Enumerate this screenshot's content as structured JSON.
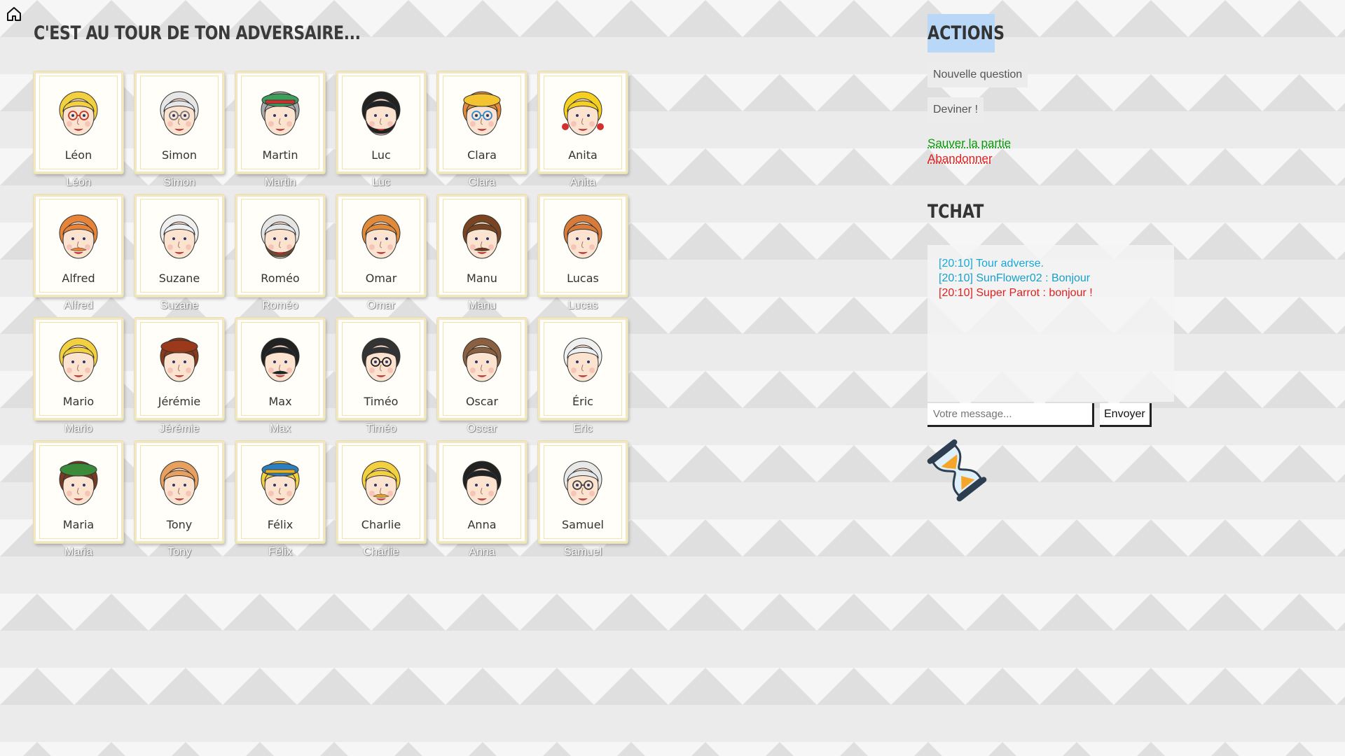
{
  "page": {
    "title": "C'EST AU TOUR DE TON ADVERSAIRE..."
  },
  "board": {
    "rows": [
      [
        {
          "name": "Léon",
          "hair": "#f2d040",
          "skin": "#fbe3cf",
          "glasses": "#c0392b",
          "beard": ""
        },
        {
          "name": "Simon",
          "hair": "#e6e6e6",
          "skin": "#fbe3cf",
          "glasses": "#777777",
          "beard": ""
        },
        {
          "name": "Martin",
          "hair": "#aaaaaa",
          "skin": "#fbe3cf",
          "hat": "#3aa05a",
          "hatband": "#d03030",
          "beard": ""
        },
        {
          "name": "Luc",
          "hair": "#222222",
          "skin": "#fbe3cf",
          "beard": "#222222"
        },
        {
          "name": "Clara",
          "hair": "#e08a3a",
          "skin": "#fbe3cf",
          "hat": "#f4c430",
          "glasses": "#2a8ad0",
          "beard": ""
        },
        {
          "name": "Anita",
          "hair": "#f5d020",
          "skin": "#fbe3cf",
          "bows": "#d03030",
          "beard": ""
        }
      ],
      [
        {
          "name": "Alfred",
          "hair": "#e8843a",
          "skin": "#fbe3cf",
          "beard": "",
          "mustache": "#e8843a"
        },
        {
          "name": "Suzane",
          "hair": "#f0f0f0",
          "skin": "#fbe3cf",
          "beard": ""
        },
        {
          "name": "Roméo",
          "hair": "#e5e5e5",
          "skin": "#fbe3cf",
          "beard": "#6a4a32"
        },
        {
          "name": "Omar",
          "hair": "#e08a3a",
          "skin": "#fbe3cf",
          "beard": ""
        },
        {
          "name": "Manu",
          "hair": "#7a4420",
          "skin": "#fbe3cf",
          "beard": "",
          "mustache": "#6a3a1a"
        },
        {
          "name": "Lucas",
          "hair": "#d87a3a",
          "skin": "#fbe3cf",
          "beard": ""
        }
      ],
      [
        {
          "name": "Mario",
          "hair": "#f2d040",
          "skin": "#fbe3cf",
          "beard": ""
        },
        {
          "name": "Jérémie",
          "hair": "#8a3a1a",
          "skin": "#fbe3cf",
          "hat": "#9a3a1a",
          "beard": ""
        },
        {
          "name": "Max",
          "hair": "#222222",
          "skin": "#fbe3cf",
          "beard": "",
          "mustache": "#222222"
        },
        {
          "name": "Timéo",
          "hair": "#333333",
          "skin": "#fbe3cf",
          "glasses": "#222222",
          "beard": ""
        },
        {
          "name": "Oscar",
          "hair": "#8a6040",
          "skin": "#fbe3cf",
          "beard": ""
        },
        {
          "name": "Éric",
          "hair": "#f0f0f0",
          "skin": "#fbe3cf",
          "beard": ""
        }
      ],
      [
        {
          "name": "Maria",
          "hair": "#7a3a20",
          "skin": "#fbe3cf",
          "hat": "#3a8a3a",
          "beard": ""
        },
        {
          "name": "Tony",
          "hair": "#e8a060",
          "skin": "#fbe3cf",
          "beard": ""
        },
        {
          "name": "Félix",
          "hair": "#f2d040",
          "skin": "#fbe3cf",
          "hat": "#2a80c0",
          "hatband": "#e8b020",
          "beard": ""
        },
        {
          "name": "Charlie",
          "hair": "#f2d040",
          "skin": "#fbe3cf",
          "beard": "",
          "mustache": "#e0a030"
        },
        {
          "name": "Anna",
          "hair": "#222222",
          "skin": "#fbe3cf",
          "beard": ""
        },
        {
          "name": "Samuel",
          "hair": "#e8e8e8",
          "skin": "#fbe3cf",
          "glasses": "#444444",
          "beard": ""
        }
      ]
    ]
  },
  "captions": [
    [
      "Léon",
      "Simon",
      "Martin",
      "Luc",
      "Clara",
      "Anita"
    ],
    [
      "Alfred",
      "Suzane",
      "Roméo",
      "Omar",
      "Manu",
      "Lucas"
    ],
    [
      "Mario",
      "Jérémie",
      "Max",
      "Timéo",
      "Oscar",
      "Eric"
    ],
    [
      "Maria",
      "Tony",
      "Félix",
      "Charlie",
      "Anna",
      "Samuel"
    ]
  ],
  "actions": {
    "title": "ACTIONS",
    "new_question": "Nouvelle question",
    "guess": "Deviner !",
    "save": "Sauver la partie",
    "quit": "Abandonner"
  },
  "chat": {
    "title": "TCHAT",
    "messages": [
      {
        "text": "[20:10] Tour adverse.",
        "kind": "system"
      },
      {
        "text": "[20:10] SunFlower02 : Bonjour",
        "kind": "other"
      },
      {
        "text": "[20:10] Super Parrot : bonjour !",
        "kind": "self"
      }
    ],
    "input_placeholder": "Votre message...",
    "send_label": "Envoyer"
  },
  "icons": {
    "home": "home-icon",
    "hourglass": "hourglass-icon"
  },
  "colors": {
    "actions_title_bg": "#b9d7f6",
    "save_link": "#0c9a0c",
    "quit_link": "#e02020",
    "chat_system": "#18a8d8",
    "chat_self": "#e02020"
  }
}
